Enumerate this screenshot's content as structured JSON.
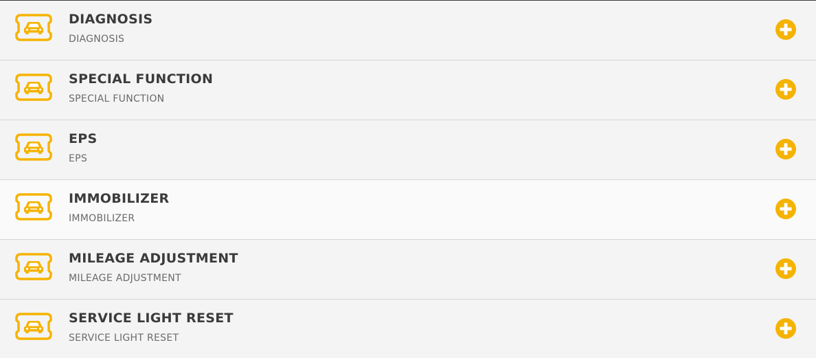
{
  "accent_color": "#f5b301",
  "icon_names": {
    "item": "car-icon",
    "action": "plus-circle-icon"
  },
  "items": [
    {
      "title": "DIAGNOSIS",
      "subtitle": "DIAGNOSIS"
    },
    {
      "title": "SPECIAL FUNCTION",
      "subtitle": "SPECIAL FUNCTION"
    },
    {
      "title": "EPS",
      "subtitle": "EPS"
    },
    {
      "title": "IMMOBILIZER",
      "subtitle": "IMMOBILIZER"
    },
    {
      "title": "MILEAGE ADJUSTMENT",
      "subtitle": "MILEAGE ADJUSTMENT"
    },
    {
      "title": "SERVICE LIGHT RESET",
      "subtitle": "SERVICE LIGHT RESET"
    }
  ]
}
